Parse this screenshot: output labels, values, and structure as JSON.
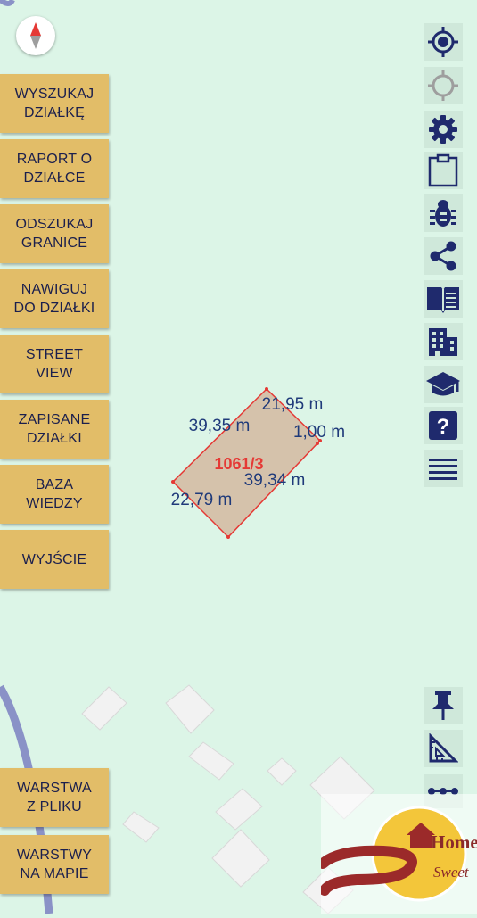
{
  "menu": [
    {
      "label": "WYSZUKAJ\nDZIAŁKĘ"
    },
    {
      "label": "RAPORT O\nDZIAŁCE"
    },
    {
      "label": "ODSZUKAJ\nGRANICE"
    },
    {
      "label": "NAWIGUJ\nDO DZIAŁKI"
    },
    {
      "label": "STREET\nVIEW"
    },
    {
      "label": "ZAPISANE\nDZIAŁKI"
    },
    {
      "label": "BAZA\nWIEDZY"
    },
    {
      "label": "WYJŚCIE"
    }
  ],
  "bottom_menu": [
    {
      "label": "WARSTWA\nZ PLIKU"
    },
    {
      "label": "WARSTWY\nNA MAPIE"
    }
  ],
  "parcel": {
    "id": "1061/3",
    "edges": [
      "21,95 m",
      "39,35 m",
      "1,00 m",
      "39,34 m",
      "22,79 m"
    ]
  },
  "toolbar_icons": [
    "my-location-icon",
    "location-outline-icon",
    "settings-icon",
    "clipboard-icon",
    "bug-icon",
    "share-icon",
    "book-icon",
    "building-icon",
    "school-icon",
    "help-icon",
    "menu-icon"
  ],
  "bottom_tools": [
    "pin-icon",
    "ruler-icon",
    "dots-icon"
  ],
  "watermark": {
    "line1": "Home",
    "line2": "Sweet"
  },
  "colors": {
    "map_background": "#dcf5e7",
    "button": "#e2bd68",
    "button_text": "#1b1f4d",
    "icon": "#1f2a6d",
    "parcel_line": "#e53935",
    "parcel_label": "#e53935",
    "measure_label": "#1f3a7a"
  }
}
